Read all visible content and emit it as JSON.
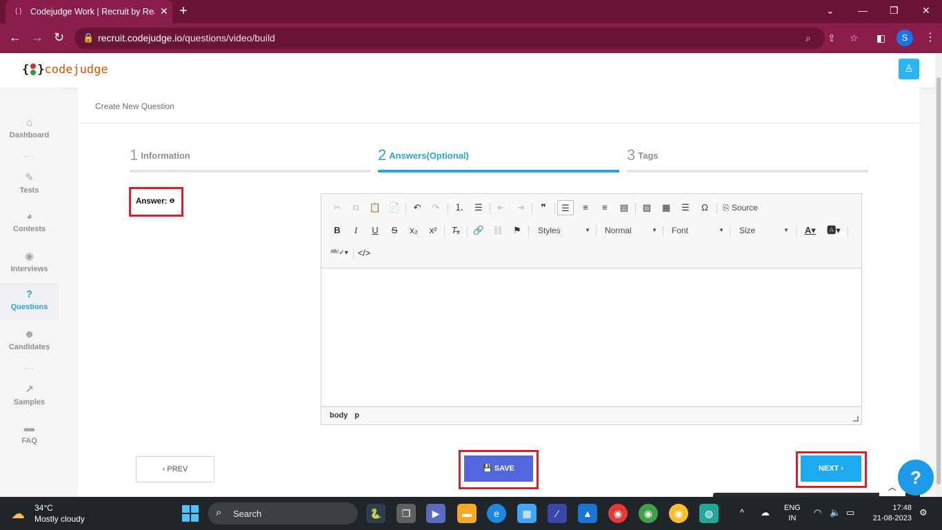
{
  "browser": {
    "tab_title": "Codejudge Work | Recruit by Real",
    "url_host": "recruit.codejudge.io",
    "url_path": "/questions/video/build",
    "profile_initial": "S"
  },
  "app": {
    "logo_text": "codejudge",
    "logo_open": "{",
    "logo_close": "}"
  },
  "sidebar": {
    "items": [
      {
        "label": "Dashboard",
        "icon": "home-icon"
      },
      {
        "label": "Tests",
        "icon": "pencil-icon"
      },
      {
        "label": "Contests",
        "icon": "pie-chart-icon"
      },
      {
        "label": "Interviews",
        "icon": "podcast-icon"
      },
      {
        "label": "Questions",
        "icon": "question-circle-icon"
      },
      {
        "label": "Candidates",
        "icon": "users-icon"
      },
      {
        "label": "Samples",
        "icon": "line-chart-icon"
      },
      {
        "label": "FAQ",
        "icon": "comments-icon"
      }
    ],
    "active": "Questions",
    "dots": "···"
  },
  "card": {
    "title": "Create New Question",
    "steps": [
      {
        "num": "1",
        "label": "Information"
      },
      {
        "num": "2",
        "label": "Answers(Optional)"
      },
      {
        "num": "3",
        "label": "Tags"
      }
    ],
    "answer_label": "Answer:",
    "info_glyph": "❶"
  },
  "editor": {
    "source_label": "Source",
    "styles_label": "Styles",
    "format_label": "Normal",
    "font_label": "Font",
    "size_label": "Size",
    "path": [
      "body",
      "p"
    ]
  },
  "buttons": {
    "prev": "‹ PREV",
    "save": "SAVE",
    "next": "NEXT ›"
  },
  "help": {
    "label": "?"
  },
  "taskbar": {
    "temp": "34°C",
    "weather": "Mostly cloudy",
    "search_placeholder": "Search",
    "lang_line1": "ENG",
    "lang_line2": "IN",
    "time": "17:48",
    "date": "21-08-2023"
  },
  "colors": {
    "chrome_dark": "#6b1437",
    "chrome": "#8a1e4b",
    "accent": "#29a3d8",
    "save": "#5266dd",
    "next": "#1eaaf1",
    "highlight": "#d8202a"
  }
}
